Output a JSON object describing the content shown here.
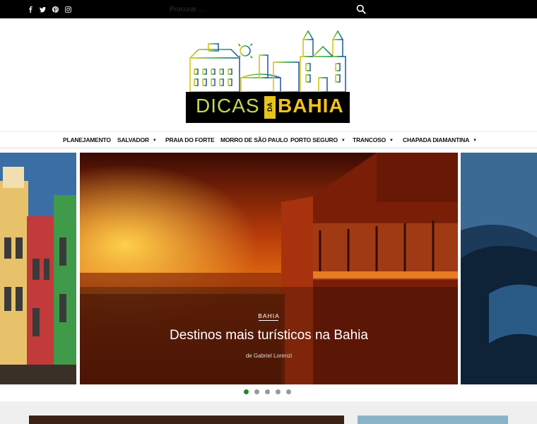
{
  "topbar": {
    "social": [
      {
        "name": "facebook-icon",
        "glyph": "f"
      },
      {
        "name": "twitter-icon",
        "glyph": "t"
      },
      {
        "name": "pinterest-icon",
        "glyph": "p"
      },
      {
        "name": "instagram-icon",
        "glyph": "i"
      }
    ],
    "search": {
      "placeholder": "Procurar ..."
    }
  },
  "logo": {
    "part1": "DICAS",
    "part2": "DA",
    "part3": "BAHIA"
  },
  "nav": {
    "items": [
      {
        "label": "PLANEJAMENTO",
        "dropdown": false
      },
      {
        "label": "SALVADOR",
        "dropdown": true
      },
      {
        "label": "PRAIA DO FORTE",
        "dropdown": false
      },
      {
        "label": "MORRO DE SÃO PAULO",
        "dropdown": false
      },
      {
        "label": "PORTO SEGURO",
        "dropdown": true
      },
      {
        "label": "TRANCOSO",
        "dropdown": true
      },
      {
        "label": "CHAPADA DIAMANTINA",
        "dropdown": true
      }
    ],
    "caret": "▼"
  },
  "slider": {
    "category": "BAHIA",
    "title": "Destinos mais turísticos na Bahia",
    "author": "de Gabriel Lorenzi",
    "dot_count": 5,
    "active_dot": 0
  },
  "colors": {
    "accent": "#1a8a2e",
    "topbar": "#000000",
    "logo_yellow": "#f2c21c",
    "logo_green": "#c6d94a"
  }
}
